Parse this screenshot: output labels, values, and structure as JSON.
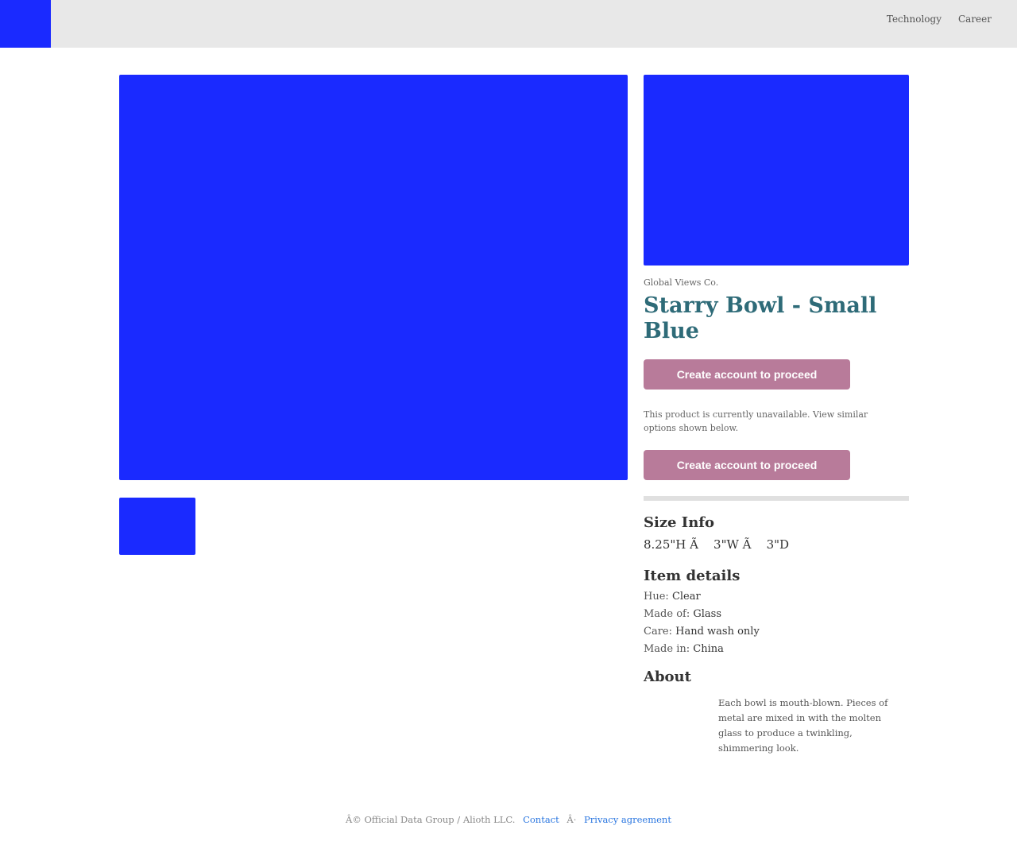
{
  "header": {
    "logo_color": "#1a2aff",
    "nav": [
      "Technology",
      "Career"
    ]
  },
  "product": {
    "brand": "Global Views Co.",
    "title": "Starry Bowl - Small Blue",
    "cta_label": "Create account to proceed",
    "unavailable_notice": "This product is currently unavailable. View similar options shown below.",
    "image_placeholder_color": "#1a2aff",
    "cta_color": "#b87b9a",
    "title_color": "#2e6b78"
  },
  "size_info": {
    "heading": "Size Info",
    "dimensions": "8.25\"H Ã    3\"W Ã    3\"D"
  },
  "item_details": {
    "heading": "Item details",
    "rows": [
      {
        "label": "Hue:",
        "value": "Clear"
      },
      {
        "label": "Made of:",
        "value": "Glass"
      },
      {
        "label": "Care:",
        "value": "Hand wash only"
      },
      {
        "label": "Made in:",
        "value": "China"
      }
    ]
  },
  "about": {
    "heading": "About",
    "text": "Each bowl is mouth-blown. Pieces of metal are mixed in with the molten glass to produce a twinkling, shimmering look."
  },
  "footer": {
    "copyright": "Â© Official Data Group / Alioth LLC.",
    "contact": "Contact",
    "separator": "Â·",
    "privacy": "Privacy agreement"
  }
}
